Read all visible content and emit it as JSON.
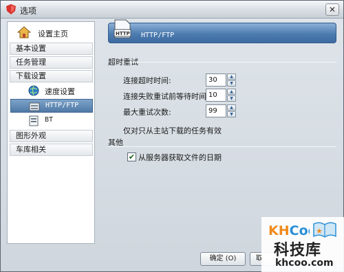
{
  "window": {
    "title": "选项"
  },
  "sidebar": {
    "home_label": "设置主页",
    "categories": [
      "基本设置",
      "任务管理",
      "下载设置",
      "图形外观",
      "车库相关"
    ],
    "subitems": [
      "速度设置",
      "HTTP/FTP",
      "BT"
    ]
  },
  "content": {
    "banner_title": "HTTP/FTP",
    "retry": {
      "heading": "超时重试",
      "timeout_label": "连接超时时间:",
      "timeout_value": "30",
      "wait_label": "连接失败重试前等待时间:",
      "wait_value": "10",
      "max_label": "最大重试次数:",
      "max_value": "99"
    },
    "note": "仅对只从主站下载的任务有效",
    "other": {
      "heading": "其他",
      "server_date_label": "从服务器获取文件的日期",
      "server_date_checked": true
    }
  },
  "buttons": {
    "ok": "确定 (O)",
    "cancel": "取"
  },
  "watermark": {
    "logo": "KHCoo",
    "cn": "科技库",
    "url": "khcoo.com"
  },
  "colors": {
    "banner": "#4d7cb0",
    "selected": "#5c84b0",
    "wm_orange": "#f08a1c",
    "wm_blue": "#2a8fd6"
  },
  "icons": {
    "app": "shield-icon",
    "home": "home-icon",
    "speed": "globe-icon",
    "http": "server-icon",
    "bt": "bt-icon",
    "banner": "document-icon",
    "spin_up": "arrow-up-icon",
    "spin_down": "arrow-down-icon",
    "close": "close-icon",
    "check": "checkmark-icon"
  }
}
